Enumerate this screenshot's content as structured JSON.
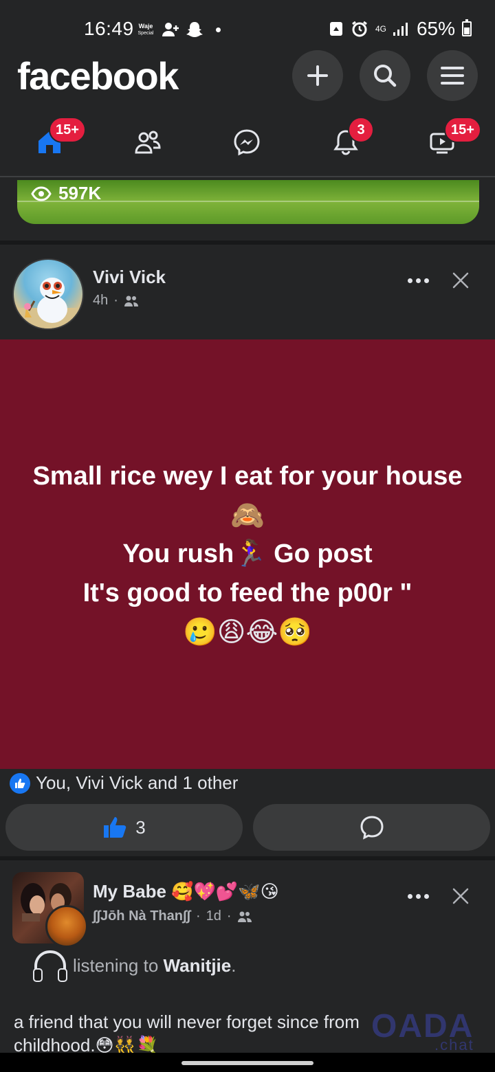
{
  "status_bar": {
    "time": "16:49",
    "left_badge": "Waje\nSpecial",
    "network": "4G",
    "battery": "65%"
  },
  "header": {
    "logo": "facebook"
  },
  "tabs": [
    {
      "name": "home",
      "badge": "15+"
    },
    {
      "name": "friends",
      "badge": ""
    },
    {
      "name": "messenger",
      "badge": ""
    },
    {
      "name": "notifications",
      "badge": "3"
    },
    {
      "name": "video",
      "badge": "15+"
    }
  ],
  "prev_post": {
    "views": "597K"
  },
  "post1": {
    "author": "Vivi Vick",
    "time": "4h",
    "lines": [
      "Small rice wey I eat for your house",
      "🙈",
      "You rush🏃‍♀️ Go post",
      "It's good to feed the p00r \"",
      "🥲😩😂🥺"
    ],
    "reactions_text": "You, Vivi Vick  and 1 other",
    "like_count": "3"
  },
  "post2": {
    "author": "My Babe 🥰💖💕🦋😘",
    "subtitle": "∫∫Jōh Nà Than∫∫",
    "time": "1d",
    "listening_prefix": "listening to ",
    "listening_song": "Wanitjie",
    "listening_suffix": ".",
    "body_line1": "a friend that you will never forget since from",
    "body_line2": "childhood.😳👯💐"
  },
  "watermark": {
    "brand": "OADA",
    "suffix": ".chat"
  },
  "colors": {
    "background": "#242526",
    "post_bg": "#741228",
    "accent": "#1877f2",
    "badge": "#e41e3f"
  }
}
